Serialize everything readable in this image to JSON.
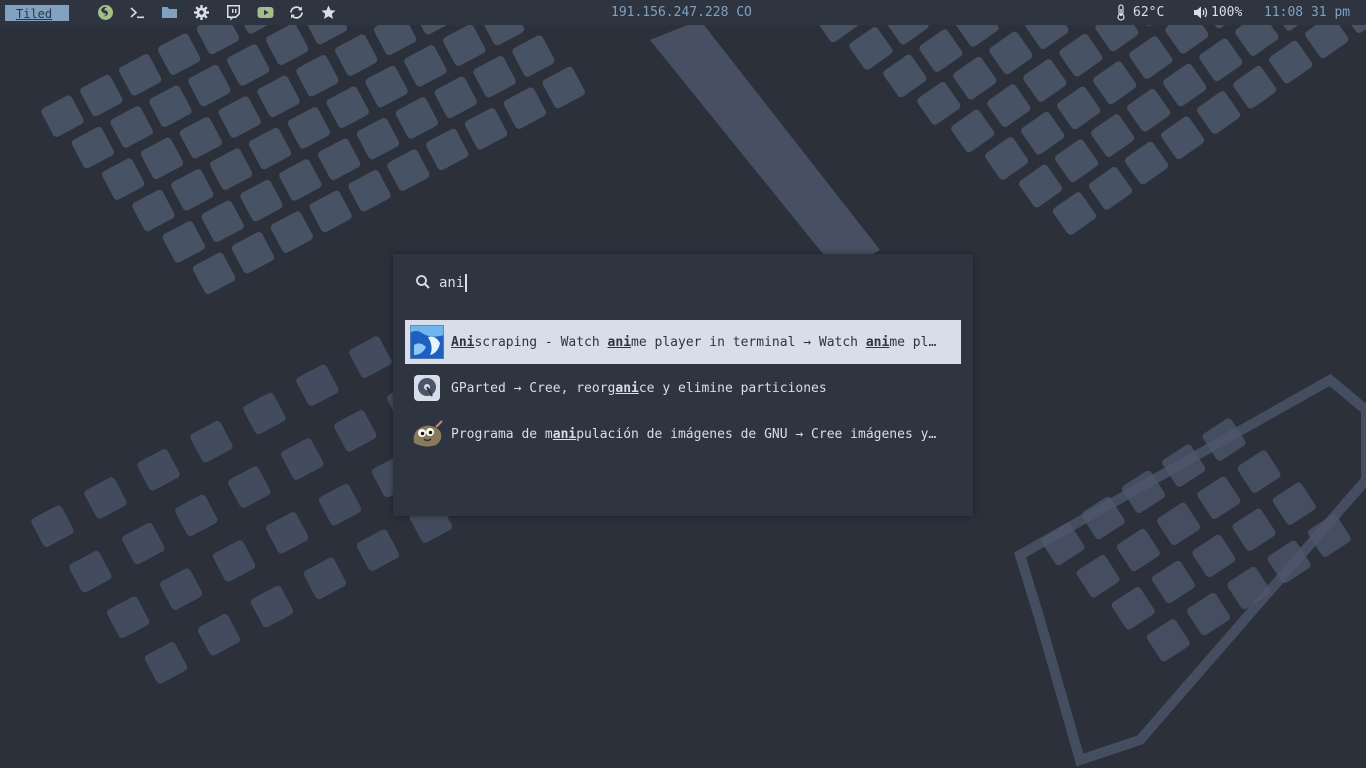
{
  "topbar": {
    "layout": "Tiled",
    "launchers": [
      {
        "icon": "firefox-icon"
      },
      {
        "icon": "terminal-icon"
      },
      {
        "icon": "folder-icon"
      },
      {
        "icon": "gear-icon"
      },
      {
        "icon": "twitch-icon"
      },
      {
        "icon": "youtube-icon"
      },
      {
        "icon": "refresh-icon"
      },
      {
        "icon": "star-icon"
      }
    ],
    "ip": "191.156.247.228 CO",
    "temperature": "62°C",
    "volume": "100%",
    "clock": "11:08 31 pm"
  },
  "launcher": {
    "query": "ani",
    "results": [
      {
        "icon": "aniscraping-icon",
        "parts": [
          {
            "t": "Ani",
            "h": true
          },
          {
            "t": "scraping - Watch ",
            "h": false
          },
          {
            "t": "ani",
            "h": true
          },
          {
            "t": "me player in terminal →  Watch ",
            "h": false
          },
          {
            "t": "ani",
            "h": true
          },
          {
            "t": "me pl…",
            "h": false
          }
        ],
        "selected": true
      },
      {
        "icon": "gparted-icon",
        "parts": [
          {
            "t": "GParted →  Cree, reorg",
            "h": false
          },
          {
            "t": "ani",
            "h": true
          },
          {
            "t": "ce y elimine particiones",
            "h": false
          }
        ],
        "selected": false
      },
      {
        "icon": "gimp-icon",
        "parts": [
          {
            "t": "Programa de m",
            "h": false
          },
          {
            "t": "ani",
            "h": true
          },
          {
            "t": "pulación de imágenes de GNU →  Cree imágenes y…",
            "h": false
          }
        ],
        "selected": false
      }
    ]
  },
  "colors": {
    "bar_bg": "#2e3440",
    "accent": "#81a1c1",
    "text": "#d8dee9",
    "selection_bg": "#d8dee9",
    "selection_fg": "#2e3440",
    "wallpaper_dark": "#2b303b",
    "wallpaper_keys": "#4c566a"
  }
}
